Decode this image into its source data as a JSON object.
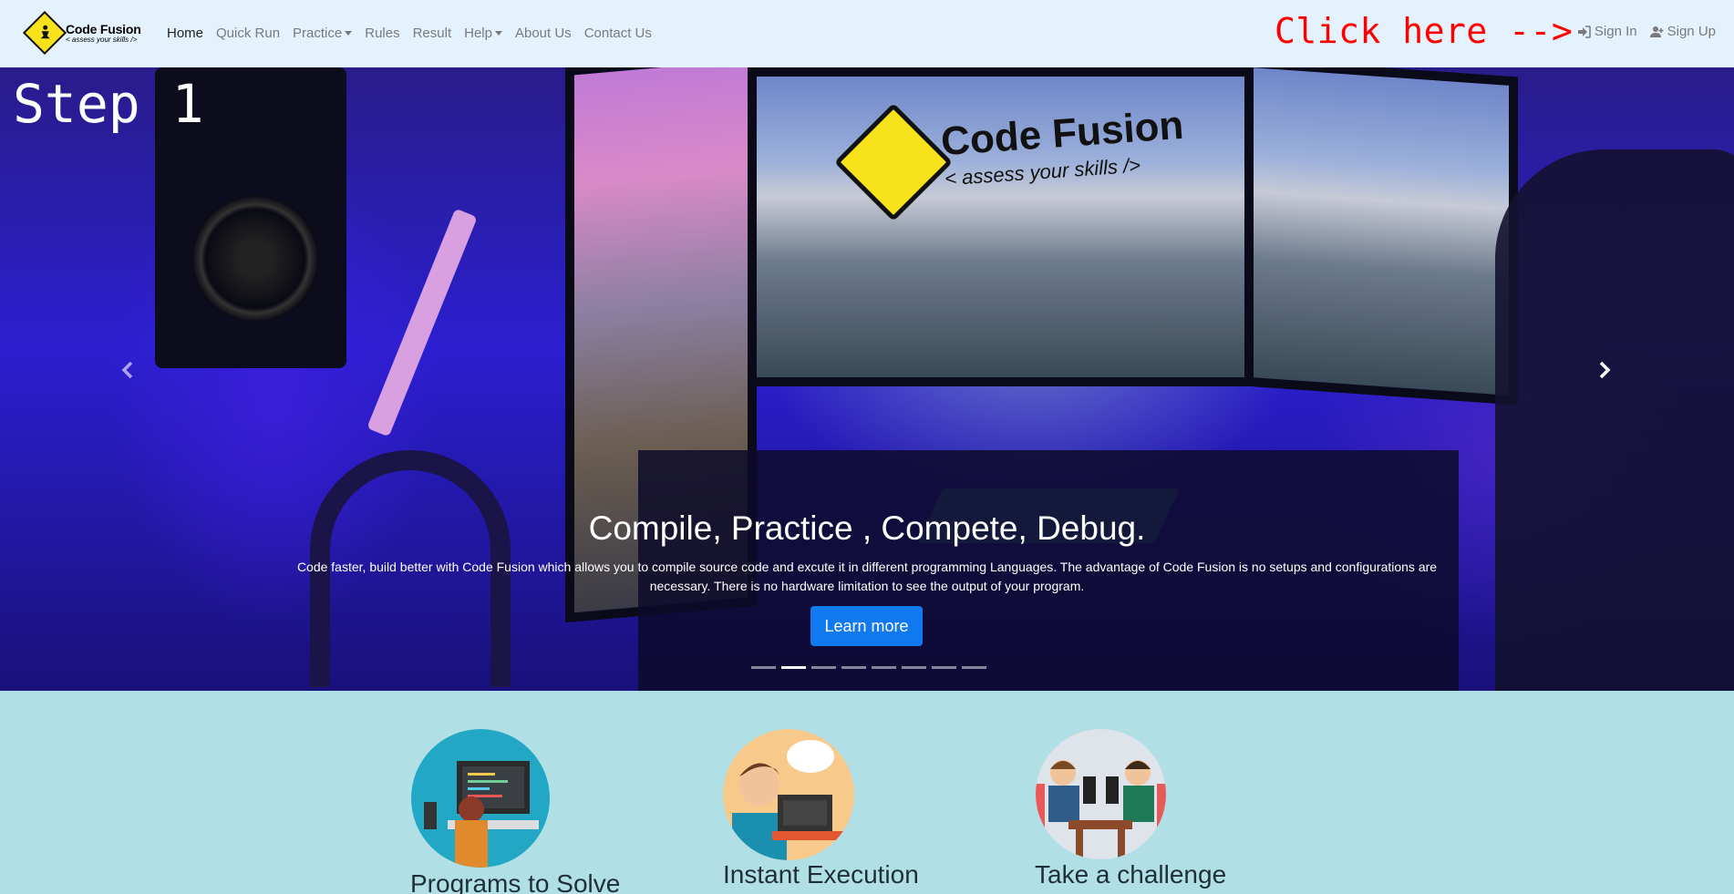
{
  "brand": {
    "title": "Code Fusion",
    "subtitle": "< assess your skills />"
  },
  "nav": {
    "items": [
      {
        "label": "Home",
        "active": true
      },
      {
        "label": "Quick Run"
      },
      {
        "label": "Practice",
        "dropdown": true
      },
      {
        "label": "Rules"
      },
      {
        "label": "Result"
      },
      {
        "label": "Help",
        "dropdown": true
      },
      {
        "label": "About Us"
      },
      {
        "label": "Contact Us"
      }
    ],
    "annotation": "Click here -->",
    "sign_in": "Sign In",
    "sign_up": "Sign Up"
  },
  "hero": {
    "overlay_label": "Step 1",
    "logo_title": "Code Fusion",
    "logo_subtitle": "< assess your skills />",
    "caption_title": "Compile, Practice , Compete, Debug.",
    "caption_text": "Code faster, build better with Code Fusion which allows you to compile source code and excute it in different programming Languages. The advantage of Code Fusion is no setups and configurations are necessary. There is no hardware limitation to see the output of your program.",
    "button_label": "Learn more",
    "slide_count": 8,
    "active_slide": 2
  },
  "features": [
    {
      "title": "Programs to Solve"
    },
    {
      "title": "Instant Execution"
    },
    {
      "title": "Take a challenge"
    }
  ],
  "colors": {
    "navbar_bg": "#e3f2fd",
    "annotation": "#ff0000",
    "button": "#1179f0",
    "features_bg": "#b0e0e6"
  }
}
